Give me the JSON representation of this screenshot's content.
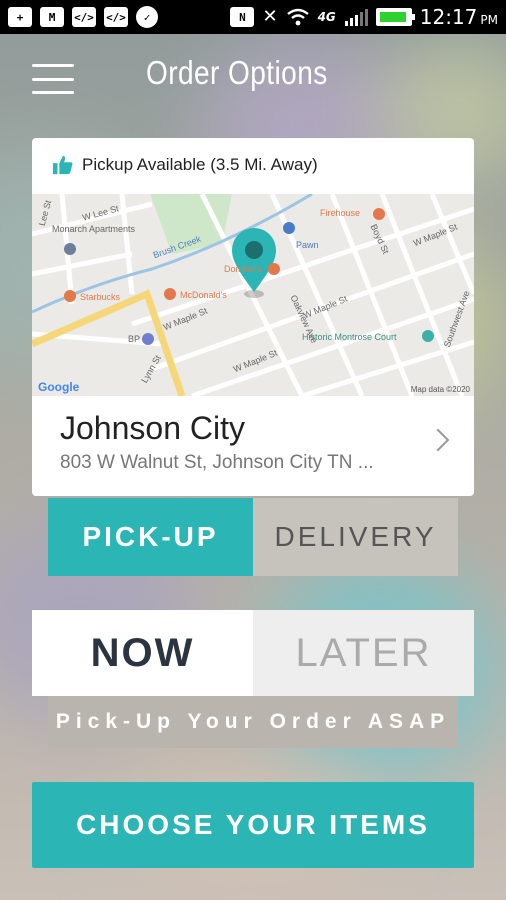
{
  "status_bar": {
    "time": "12:17",
    "ampm": "PM",
    "network": "4G",
    "left_icons": [
      "plus-icon",
      "gmail-icon",
      "code-icon",
      "code-icon",
      "chat-icon"
    ],
    "right_icons": [
      "nfc-icon",
      "mute-icon",
      "wifi-icon",
      "signal-icon",
      "battery-icon"
    ]
  },
  "header": {
    "title": "Order Options"
  },
  "location_card": {
    "availability_text": "Pickup Available (3.5 Mi. Away)",
    "city": "Johnson City",
    "address": "803 W Walnut St, Johnson City TN ...",
    "map": {
      "labels": {
        "monarch": "Monarch Apartments",
        "brush_creek": "Brush Creek",
        "firehouse": "Firehouse",
        "pawn": "Pawn",
        "dominos": "Domino's",
        "mcdonalds": "McDonald's",
        "starbucks": "Starbucks",
        "bp": "BP",
        "historic": "Historic Montrose Court",
        "w_maple_1": "W Maple St",
        "w_maple_2": "W Maple St",
        "w_maple_3": "W Maple St",
        "w_maple_4": "W Maple St",
        "w_lee": "W Lee St",
        "lynn": "Lynn St",
        "lee": "Lee St",
        "boyd": "Boyd St",
        "oakview": "Oakview Ave",
        "southwest": "Southwest Ave"
      },
      "google": "Google",
      "credit": "Map data ©2020"
    }
  },
  "fulfillment": {
    "pickup": "PICK-UP",
    "delivery": "DELIVERY",
    "selected": "pickup"
  },
  "timing": {
    "now": "NOW",
    "later": "LATER",
    "selected": "now"
  },
  "asap_banner": "Pick-Up Your Order ASAP",
  "cta": "CHOOSE YOUR ITEMS",
  "colors": {
    "accent": "#2bb6b5",
    "pin": "#2bb6b5"
  }
}
